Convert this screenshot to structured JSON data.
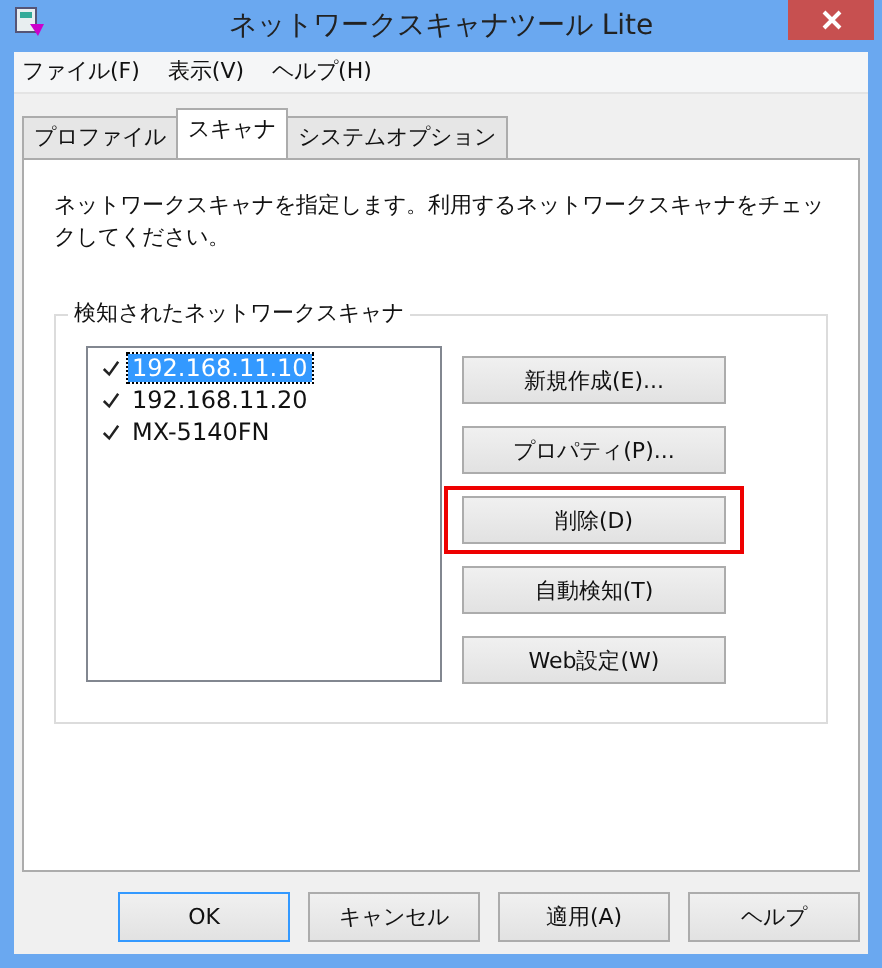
{
  "window": {
    "title": "ネットワークスキャナツール Lite"
  },
  "menu": [
    "ファイル(F)",
    "表示(V)",
    "ヘルプ(H)"
  ],
  "tabs": [
    {
      "label": "プロファイル",
      "selected": false
    },
    {
      "label": "スキャナ",
      "selected": true
    },
    {
      "label": "システムオプション",
      "selected": false
    }
  ],
  "description": "ネットワークスキャナを指定します。利用するネットワークスキャナをチェックしてください。",
  "group": {
    "title": "検知されたネットワークスキャナ",
    "scanners": [
      {
        "name": "192.168.11.10",
        "checked": true,
        "selected": true
      },
      {
        "name": "192.168.11.20",
        "checked": true,
        "selected": false
      },
      {
        "name": "MX-5140FN",
        "checked": true,
        "selected": false
      }
    ],
    "buttons": [
      {
        "label": "新規作成(E)...",
        "highlighted": false
      },
      {
        "label": "プロパティ(P)...",
        "highlighted": false
      },
      {
        "label": "削除(D)",
        "highlighted": true
      },
      {
        "label": "自動検知(T)",
        "highlighted": false
      },
      {
        "label": "Web設定(W)",
        "highlighted": false
      }
    ]
  },
  "footer_buttons": [
    {
      "label": "OK",
      "default": true
    },
    {
      "label": "キャンセル",
      "default": false
    },
    {
      "label": "適用(A)",
      "default": false
    },
    {
      "label": "ヘルプ",
      "default": false
    }
  ]
}
